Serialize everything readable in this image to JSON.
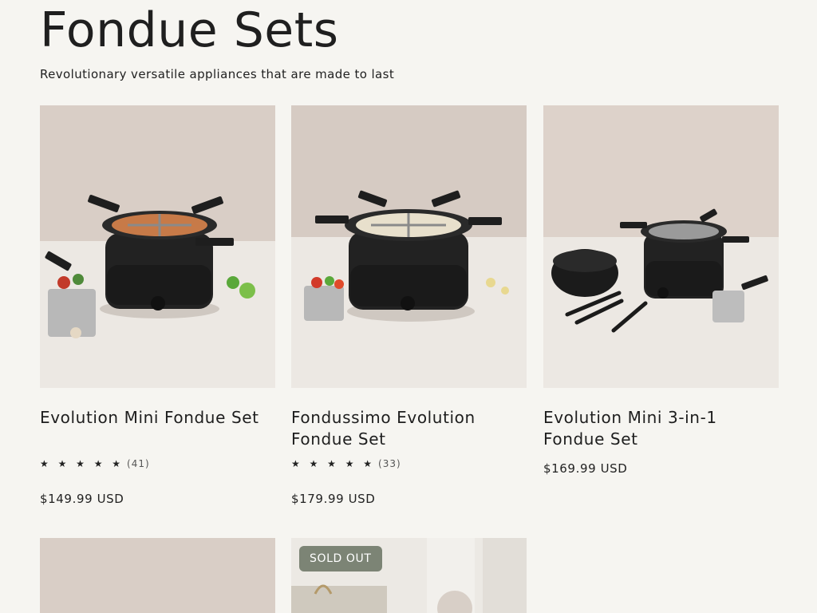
{
  "page": {
    "title": "Fondue Sets",
    "subtitle": "Revolutionary versatile appliances that are made to last"
  },
  "products": [
    {
      "name": "Evolution Mini Fondue Set",
      "stars": "★ ★ ★ ★ ★",
      "rating": 5,
      "reviews": "(41)",
      "price": "$149.99 USD"
    },
    {
      "name": "Fondussimo Evolution Fondue Set",
      "stars": "★ ★ ★ ★ ★",
      "rating": 5,
      "reviews": "(33)",
      "price": "$179.99 USD"
    },
    {
      "name": "Evolution Mini 3-in-1 Fondue Set",
      "price": "$169.99 USD"
    },
    {
      "name": ""
    },
    {
      "badge": "SOLD OUT"
    }
  ],
  "colors": {
    "background": "#f6f5f1",
    "wall": "#d9cec6",
    "counter": "#ece8e3",
    "badge": "#7c8475"
  }
}
